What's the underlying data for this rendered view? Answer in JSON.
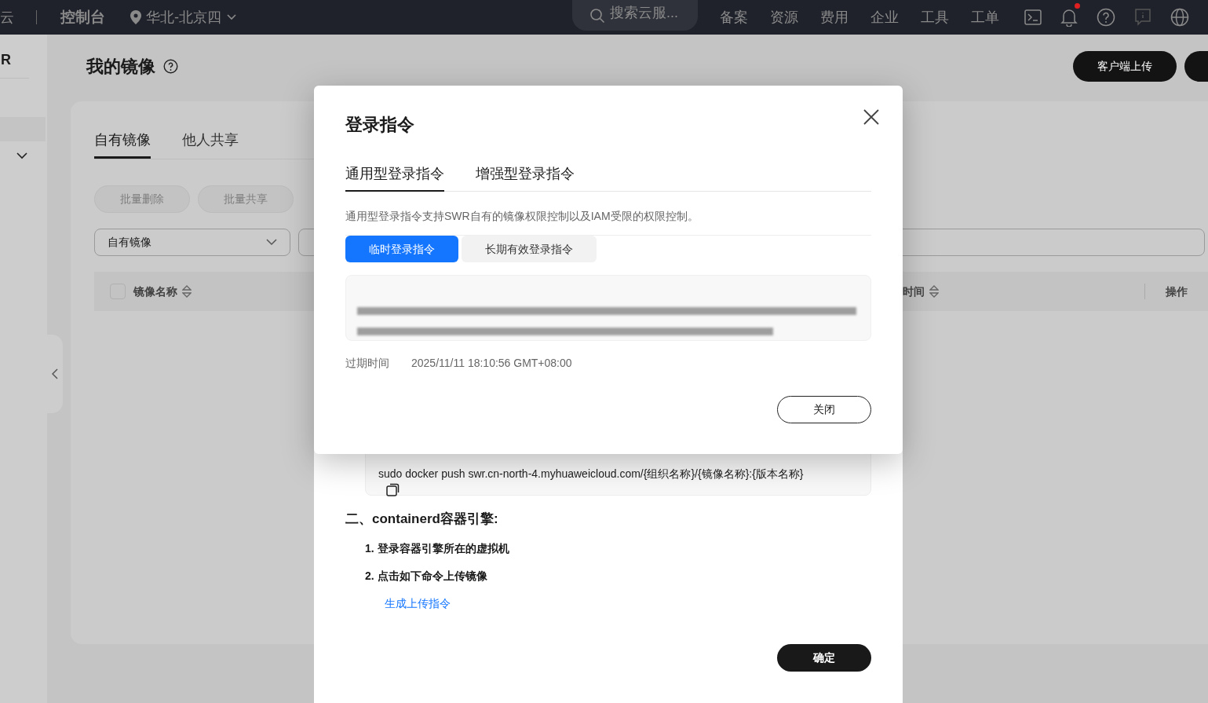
{
  "top_bar": {
    "logo_text": "云",
    "console": "控制台",
    "region": "华北-北京四",
    "search": {
      "placeholder": "搜索云服..."
    },
    "nav_items": [
      "备案",
      "资源",
      "费用",
      "企业",
      "工具",
      "工单"
    ],
    "notification_dot": true
  },
  "sidebar": {
    "title": "R"
  },
  "page": {
    "title": "我的镜像",
    "buttons": [
      "客户端上传"
    ],
    "tabs": [
      {
        "label": "自有镜像",
        "selected": true
      },
      {
        "label": "他人共享",
        "selected": false
      }
    ],
    "actions": [
      {
        "label": "批量删除",
        "disabled": true
      },
      {
        "label": "批量共享",
        "disabled": true
      }
    ],
    "filter": {
      "value": "自有镜像"
    },
    "table": {
      "select_all_checked": false,
      "columns": [
        {
          "label": "镜像名称",
          "sortable": true
        },
        {
          "label": "时间",
          "sortable": true
        },
        {
          "label": "操作",
          "sortable": false
        }
      ]
    }
  },
  "upload_dialog": {
    "command": "sudo docker push swr.cn-north-4.myhuaweicloud.com/{组织名称}/{镜像名称}:{版本名称}",
    "section_title": "二、containerd容器引擎:",
    "steps": [
      "1. 登录容器引擎所在的虚拟机",
      "2. 点击如下命令上传镜像"
    ],
    "link": "生成上传指令",
    "confirm": "确定"
  },
  "login_dialog": {
    "title": "登录指令",
    "tabs": [
      {
        "label": "通用型登录指令",
        "selected": true
      },
      {
        "label": "增强型登录指令",
        "selected": false
      }
    ],
    "description": "通用型登录指令支持SWR自有的镜像权限控制以及IAM受限的权限控制。",
    "modes": [
      {
        "label": "临时登录指令",
        "selected": true
      },
      {
        "label": "长期有效登录指令",
        "selected": false
      }
    ],
    "expiry_label": "过期时间",
    "expiry_value": "2025/11/11 18:10:56 GMT+08:00",
    "close": "关闭"
  }
}
